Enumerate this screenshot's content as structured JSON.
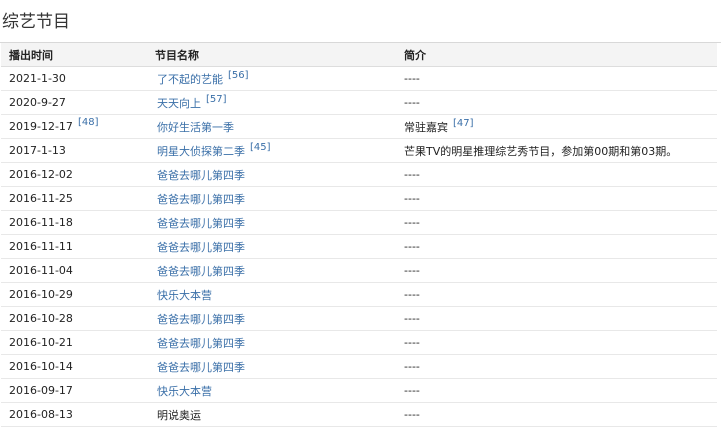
{
  "section": {
    "title": "综艺节目"
  },
  "table": {
    "headers": [
      "播出时间",
      "节目名称",
      "简介"
    ],
    "rows": [
      {
        "date": "2021-1-30",
        "date_ref": "",
        "program": "了不起的艺能",
        "program_ref": "[56]",
        "program_is_link": true,
        "note": "----",
        "note_ref": ""
      },
      {
        "date": "2020-9-27",
        "date_ref": "",
        "program": "天天向上",
        "program_ref": "[57]",
        "program_is_link": true,
        "note": "----",
        "note_ref": ""
      },
      {
        "date": "2019-12-17",
        "date_ref": "[48]",
        "program": "你好生活第一季",
        "program_ref": "",
        "program_is_link": true,
        "note": "常驻嘉宾",
        "note_ref": "[47]"
      },
      {
        "date": "2017-1-13",
        "date_ref": "",
        "program": "明星大侦探第二季",
        "program_ref": "[45]",
        "program_is_link": true,
        "note": "芒果TV的明星推理综艺秀节目，参加第00期和第03期。",
        "note_ref": ""
      },
      {
        "date": "2016-12-02",
        "date_ref": "",
        "program": "爸爸去哪儿第四季",
        "program_ref": "",
        "program_is_link": true,
        "note": "----",
        "note_ref": ""
      },
      {
        "date": "2016-11-25",
        "date_ref": "",
        "program": "爸爸去哪儿第四季",
        "program_ref": "",
        "program_is_link": true,
        "note": "----",
        "note_ref": ""
      },
      {
        "date": "2016-11-18",
        "date_ref": "",
        "program": "爸爸去哪儿第四季",
        "program_ref": "",
        "program_is_link": true,
        "note": "----",
        "note_ref": ""
      },
      {
        "date": "2016-11-11",
        "date_ref": "",
        "program": "爸爸去哪儿第四季",
        "program_ref": "",
        "program_is_link": true,
        "note": "----",
        "note_ref": ""
      },
      {
        "date": "2016-11-04",
        "date_ref": "",
        "program": "爸爸去哪儿第四季",
        "program_ref": "",
        "program_is_link": true,
        "note": "----",
        "note_ref": ""
      },
      {
        "date": "2016-10-29",
        "date_ref": "",
        "program": "快乐大本营",
        "program_ref": "",
        "program_is_link": true,
        "note": "----",
        "note_ref": ""
      },
      {
        "date": "2016-10-28",
        "date_ref": "",
        "program": "爸爸去哪儿第四季",
        "program_ref": "",
        "program_is_link": true,
        "note": "----",
        "note_ref": ""
      },
      {
        "date": "2016-10-21",
        "date_ref": "",
        "program": "爸爸去哪儿第四季",
        "program_ref": "",
        "program_is_link": true,
        "note": "----",
        "note_ref": ""
      },
      {
        "date": "2016-10-14",
        "date_ref": "",
        "program": "爸爸去哪儿第四季",
        "program_ref": "",
        "program_is_link": true,
        "note": "----",
        "note_ref": ""
      },
      {
        "date": "2016-09-17",
        "date_ref": "",
        "program": "快乐大本营",
        "program_ref": "",
        "program_is_link": true,
        "note": "----",
        "note_ref": ""
      },
      {
        "date": "2016-08-13",
        "date_ref": "",
        "program": "明说奥运",
        "program_ref": "",
        "program_is_link": false,
        "note": "----",
        "note_ref": ""
      }
    ]
  },
  "colors": {
    "link": "#3a6fa8",
    "text": "#222222",
    "header_bg": "#f4f4f4",
    "row_border": "#e8e8e8"
  }
}
